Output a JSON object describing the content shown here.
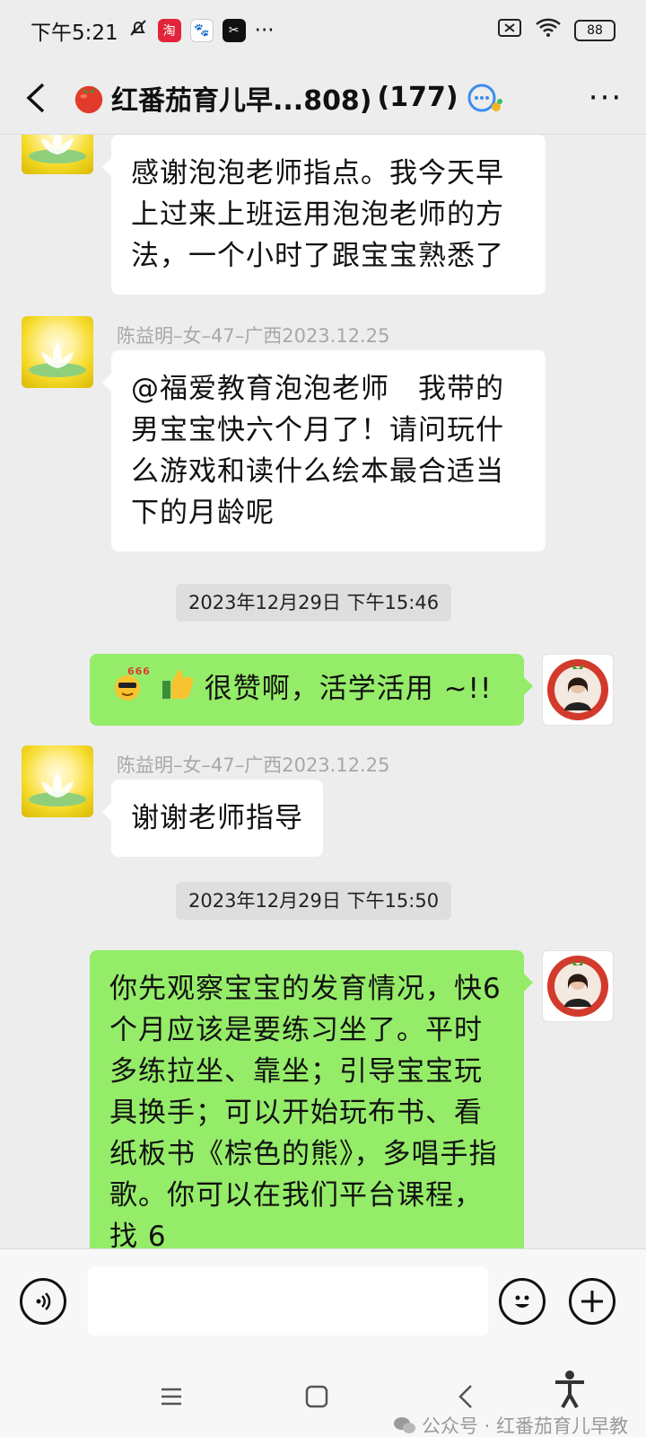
{
  "status_bar": {
    "time": "下午5:21",
    "more": "···",
    "battery": "88"
  },
  "header": {
    "title": "红番茄育儿早...808)",
    "count": "(177)",
    "more": "···"
  },
  "messages": {
    "m1": {
      "text": "感谢泡泡老师指点。我今天早上过来上班运用泡泡老师的方法，一个小时了跟宝宝熟悉了"
    },
    "m2": {
      "sender": "陈益明–女–47–广西2023.12.25",
      "text": "@福爱教育泡泡老师　我带的男宝宝快六个月了！请问玩什么游戏和读什么绘本最合适当下的月龄呢"
    },
    "ts1": "2023年12月29日 下午15:46",
    "m3": {
      "emoji_badge": "666",
      "text": "很赞啊，活学活用 ~!!"
    },
    "m4": {
      "sender": "陈益明–女–47–广西2023.12.25",
      "text": "谢谢老师指导"
    },
    "ts2": "2023年12月29日 下午15:50",
    "m5": {
      "text": "你先观察宝宝的发育情况，快6个月应该是要练习坐了。平时多练拉坐、靠坐；引导宝宝玩具换手；可以开始玩布书、看纸板书《棕色的熊》，多唱手指歌。你可以在我们平台课程，找 6"
    }
  },
  "watermark": "公众号 · 红番茄育儿早教",
  "colors": {
    "chat_bg": "#ededed",
    "bubble_self": "#95ec69",
    "bubble_other": "#ffffff"
  },
  "icons": [
    "back-icon",
    "tomato-icon",
    "group-chat-icon",
    "voice-icon",
    "emoji-icon",
    "plus-icon"
  ]
}
